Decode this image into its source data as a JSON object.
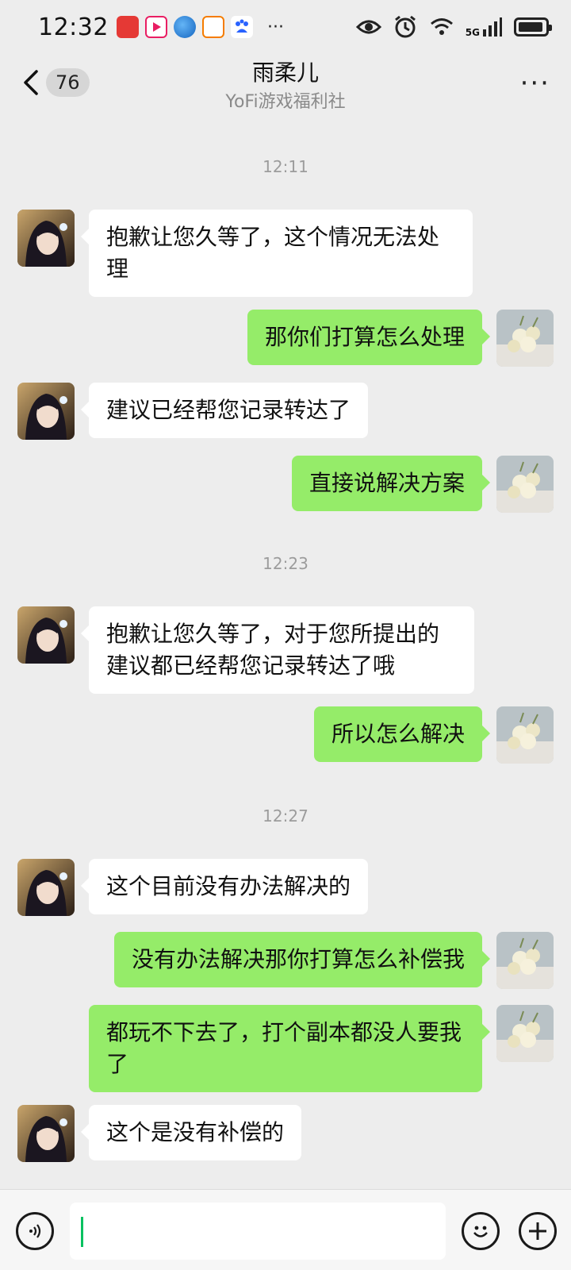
{
  "status_bar": {
    "time": "12:32",
    "network": "5G",
    "app_icons": [
      "news-app-icon",
      "video-app-icon",
      "browser-app-icon",
      "wallet-app-icon",
      "baidu-app-icon"
    ]
  },
  "header": {
    "back_count": "76",
    "title": "雨柔儿",
    "subtitle": "YoFi游戏福利社",
    "more": "···"
  },
  "messages": [
    {
      "type": "time",
      "text": "12:11"
    },
    {
      "type": "msg",
      "side": "left",
      "text": "抱歉让您久等了，这个情况无法处理"
    },
    {
      "type": "msg",
      "side": "right",
      "text": "那你们打算怎么处理"
    },
    {
      "type": "msg",
      "side": "left",
      "text": "建议已经帮您记录转达了"
    },
    {
      "type": "msg",
      "side": "right",
      "text": "直接说解决方案"
    },
    {
      "type": "time",
      "text": "12:23"
    },
    {
      "type": "msg",
      "side": "left",
      "text": "抱歉让您久等了，对于您所提出的建议都已经帮您记录转达了哦"
    },
    {
      "type": "msg",
      "side": "right",
      "text": "所以怎么解决"
    },
    {
      "type": "time",
      "text": "12:27"
    },
    {
      "type": "msg",
      "side": "left",
      "text": "这个目前没有办法解决的"
    },
    {
      "type": "msg",
      "side": "right",
      "text": "没有办法解决那你打算怎么补偿我"
    },
    {
      "type": "msg",
      "side": "right",
      "text": "都玩不下去了，打个副本都没人要我了"
    },
    {
      "type": "msg",
      "side": "left",
      "text": "这个是没有补偿的"
    }
  ],
  "input_bar": {
    "voice_icon": "voice-icon",
    "emoji_icon": "emoji-icon",
    "plus_icon": "plus-icon",
    "input_value": ""
  },
  "colors": {
    "background": "#ededed",
    "self_bubble": "#95ec69",
    "other_bubble": "#ffffff",
    "accent": "#07c160"
  }
}
